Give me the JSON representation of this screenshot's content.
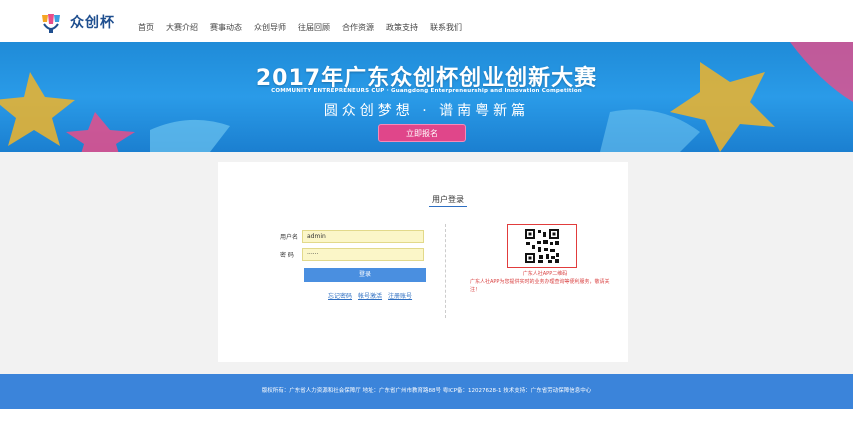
{
  "header": {
    "logo_name": "众创杯",
    "nav": [
      "首页",
      "大赛介绍",
      "赛事动态",
      "众创导师",
      "往届回顾",
      "合作资源",
      "政策支持",
      "联系我们"
    ]
  },
  "banner": {
    "title": "2017年广东众创杯创业创新大赛",
    "subtitle": "COMMUNITY ENTREPRENEURS CUP · Guangdong Enterpreneurship and Innovation Competition",
    "slogan": "圆众创梦想 · 谱南粤新篇",
    "signup_button": "立即报名"
  },
  "login": {
    "title": "用户登录",
    "username_label": "用户名",
    "username_value": "admin",
    "password_label": "密 码",
    "password_value": "······",
    "login_button": "登录",
    "links": [
      "忘记密码",
      "帐号激活",
      "注册账号"
    ]
  },
  "qr": {
    "caption": "广东人社APP二维码",
    "note": "广东人社APP为您提供实时的业务办理查询等便利服务，敬请关注！"
  },
  "footer": {
    "text": "版权所有：广东省人力资源和社会保障厅 地址：广东省广州市教育路88号 粤ICP备：12027628-1 技术支持：广东省劳动保障信息中心"
  },
  "colors": {
    "banner_blue": "#2a9be8",
    "button_pink": "#e0468a",
    "login_blue": "#4a8fe0",
    "footer_blue": "#3b84da",
    "qr_red": "#e13c3c"
  }
}
